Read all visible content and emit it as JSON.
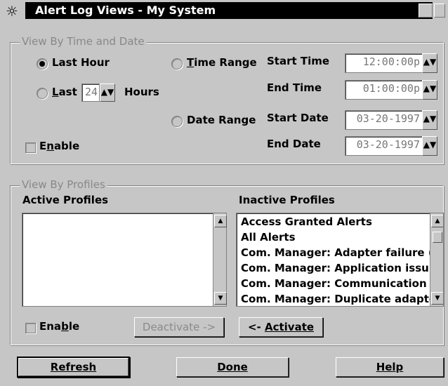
{
  "window": {
    "title": "Alert Log Views - My System",
    "icon": "system-menu-icon",
    "buttons": [
      "minimize-icon",
      "restore-icon"
    ]
  },
  "time_group": {
    "title": "View By Time and Date",
    "last_hour": "Last Hour",
    "last_prefix": "L",
    "last_rest": "ast",
    "last_hours_value": "24",
    "hours_label": "Hours",
    "time_range_prefix": "T",
    "time_range_rest": "ime Range",
    "date_range": "Date Range",
    "start_time_label": "Start Time",
    "start_time_value": "12:00:00p",
    "end_time_label": "End Time",
    "end_time_value": "01:00:00p",
    "start_date_label": "Start Date",
    "start_date_value": "03-20-1997",
    "end_date_label": "End Date",
    "end_date_value": "03-20-1997",
    "enable_prefix": "E",
    "enable_u": "n",
    "enable_rest": "able",
    "selected": "Last Hour"
  },
  "profiles_group": {
    "title": "View By Profiles",
    "active_label": "Active Profiles",
    "inactive_label": "Inactive Profiles",
    "active_items": [],
    "inactive_items": [
      "Access Granted Alerts",
      "All Alerts",
      "Com. Manager: Adapter failure (",
      "Com. Manager: Application issu",
      "Com. Manager: Communication l",
      "Com. Manager: Duplicate adapte"
    ],
    "enable_prefix": "Ena",
    "enable_u": "b",
    "enable_rest": "le",
    "deactivate_label": "Deactivate ->",
    "activate_prefix": "<- ",
    "activate_label": "Activate"
  },
  "footer": {
    "refresh": "Refresh",
    "done": "Done",
    "help": "Help"
  }
}
